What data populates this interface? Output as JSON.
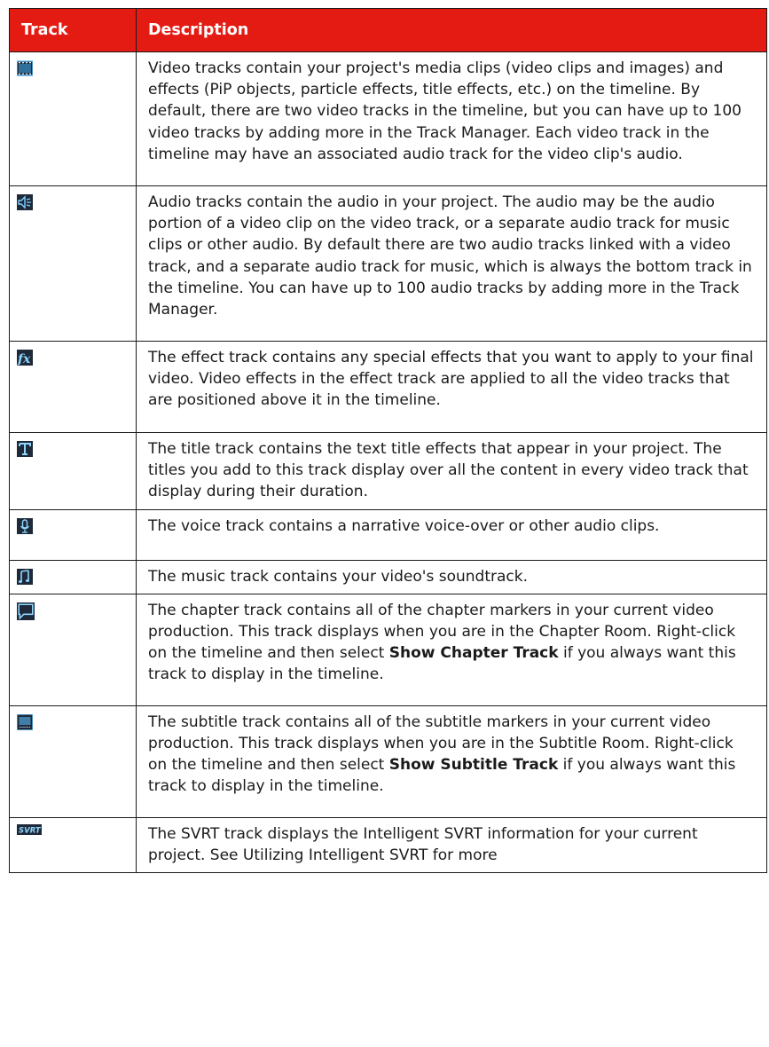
{
  "header": {
    "track": "Track",
    "description": "Description"
  },
  "rows": [
    {
      "icon": "video-track-icon",
      "text": "Video tracks contain your project's media clips (video clips and images) and effects (PiP objects, particle effects, title effects, etc.) on the timeline. By default, there are two video tracks in the timeline, but you can have up to 100 video tracks by adding more in the Track Manager. Each video track in the timeline may have an associated audio track for the video clip's audio."
    },
    {
      "icon": "audio-track-icon",
      "text": "Audio tracks contain the audio in your project. The audio may be the audio portion of a video clip on the video track, or a separate audio track for music clips or other audio. By default there are two audio tracks linked with a video track, and a separate audio track for music, which is always the bottom track in the timeline. You can have up to 100 audio tracks by adding more in the Track Manager."
    },
    {
      "icon": "effect-track-icon",
      "text": "The effect track contains any special effects that you want to apply to your final video. Video effects in the effect track are applied to all the video tracks that are positioned above it in the timeline."
    },
    {
      "icon": "title-track-icon",
      "text": "The title track contains the text title effects that appear in your project. The titles you add to this track display over all the content in every video track that display during their duration."
    },
    {
      "icon": "voice-track-icon",
      "text": "The voice track contains a narrative voice-over or other audio clips."
    },
    {
      "icon": "music-track-icon",
      "text": "The music track contains your video's soundtrack."
    },
    {
      "icon": "chapter-track-icon",
      "pre": "The chapter track contains all of the chapter markers in your current video production. This track displays when you are in the Chapter Room. Right-click on the timeline and then select ",
      "bold": "Show Chapter Track",
      "post": " if you always want this track to display in the timeline."
    },
    {
      "icon": "subtitle-track-icon",
      "pre": "The subtitle track contains all of the subtitle markers in your current video production. This track displays when you are in the Subtitle Room. Right-click on the timeline and then select ",
      "bold": "Show Subtitle Track",
      "post": " if you always want this track to display in the timeline."
    },
    {
      "icon": "svrt-track-icon",
      "icon_text": "SVRT",
      "text": "The SVRT track displays the Intelligent SVRT information for your current project. See Utilizing Intelligent SVRT for more"
    }
  ],
  "colors": {
    "header_bg": "#e41b13",
    "icon_bg": "#1e2a3a",
    "icon_accent": "#5ab4e8"
  }
}
